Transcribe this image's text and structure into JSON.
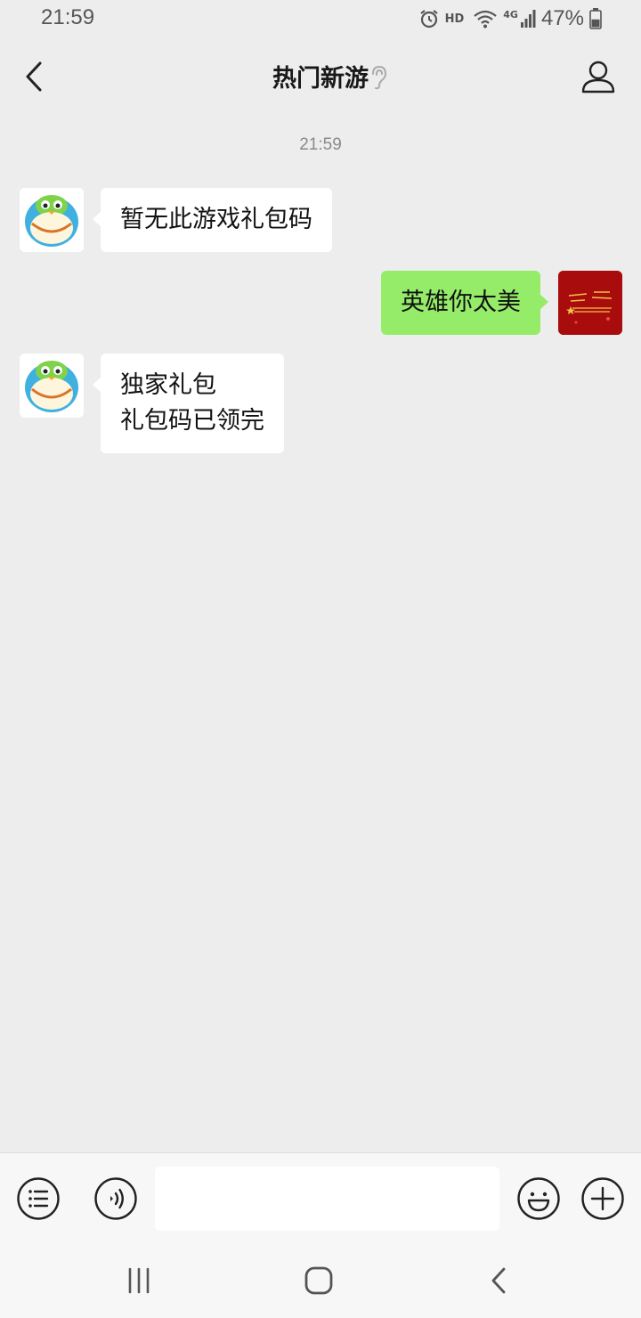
{
  "status_bar": {
    "time": "21:59",
    "hd_label": "HD",
    "network": "4G",
    "battery_percent": "47%",
    "battery_level": 0.47
  },
  "header": {
    "title": "热门新游",
    "back_icon": "chevron-left-icon",
    "ear_icon": "ear-icon",
    "profile_icon": "person-icon"
  },
  "chat": {
    "timestamp": "21:59",
    "messages": [
      {
        "side": "left",
        "text": "暂无此游戏礼包码"
      },
      {
        "side": "right",
        "text": "英雄你太美"
      },
      {
        "side": "left",
        "text": "独家礼包\n礼包码已领完"
      }
    ]
  },
  "input_bar": {
    "menu_icon": "list-menu-icon",
    "voice_icon": "voice-icon",
    "input_value": "",
    "emoji_icon": "smiley-icon",
    "add_icon": "plus-circle-icon"
  },
  "system_nav": {
    "recents_icon": "recents-icon",
    "home_icon": "home-icon",
    "back_icon": "back-icon"
  },
  "colors": {
    "background": "#ededed",
    "bubble_self": "#95ec69",
    "bubble_other": "#ffffff",
    "self_avatar": "#a80c0c"
  }
}
